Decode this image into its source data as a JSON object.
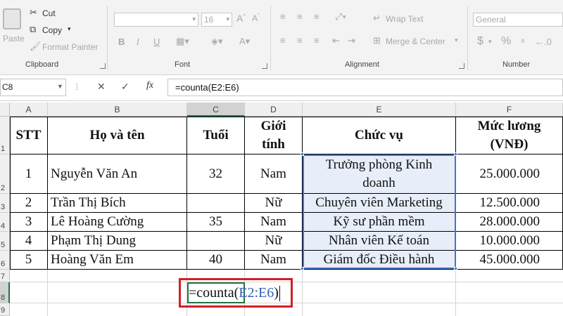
{
  "ribbon": {
    "clipboard": {
      "cut": "Cut",
      "copy": "Copy",
      "format_painter": "Format Painter",
      "paste": "Paste",
      "group_label": "Clipboard"
    },
    "font": {
      "font_size": "16",
      "group_label": "Font",
      "grow_icon": "A^",
      "shrink_icon": "Aˇ",
      "bold": "B",
      "italic": "I",
      "underline": "U"
    },
    "alignment": {
      "wrap_text": "Wrap Text",
      "merge_center": "Merge & Center",
      "group_label": "Alignment"
    },
    "number": {
      "format": "General",
      "currency": "$",
      "percent": "%",
      "group_label": "Number"
    }
  },
  "formula_bar": {
    "name_box": "C8",
    "fx": "fx",
    "formula": "=counta(E2:E6)"
  },
  "columns": [
    "A",
    "B",
    "C",
    "D",
    "E",
    "F"
  ],
  "rows": [
    "1",
    "2",
    "3",
    "4",
    "5",
    "6",
    "7",
    "8",
    "9"
  ],
  "table": {
    "headers": {
      "stt": "STT",
      "name": "Họ và tên",
      "age": "Tuổi",
      "gender_line1": "Giới",
      "gender_line2": "tính",
      "position": "Chức vụ",
      "salary_line1": "Mức lương",
      "salary_line2": "(VNĐ)"
    },
    "data": [
      {
        "stt": "1",
        "name": "Nguyễn Văn An",
        "age": "32",
        "gender": "Nam",
        "position": "Trưởng phòng Kinh doanh",
        "salary": "25.000.000"
      },
      {
        "stt": "2",
        "name": "Trần Thị Bích",
        "age": "",
        "gender": "Nữ",
        "position": "Chuyên viên Marketing",
        "salary": "12.500.000"
      },
      {
        "stt": "3",
        "name": "Lê Hoàng Cường",
        "age": "35",
        "gender": "Nam",
        "position": "Kỹ sư phần mềm",
        "salary": "28.000.000"
      },
      {
        "stt": "4",
        "name": "Phạm Thị Dung",
        "age": "",
        "gender": "Nữ",
        "position": "Nhân viên Kế toán",
        "salary": "10.000.000"
      },
      {
        "stt": "5",
        "name": "Hoàng Văn Em",
        "age": "40",
        "gender": "Nam",
        "position": "Giám đốc Điều hành",
        "salary": "45.000.000"
      }
    ]
  },
  "active_cell": {
    "fn": "=counta(",
    "ref_start": "E2",
    "ref_colon": ":",
    "ref_end": "E6",
    "close": ")"
  },
  "colors": {
    "excel_green": "#217346",
    "range_blue": "#4472c4",
    "highlight_red": "#d02027"
  }
}
